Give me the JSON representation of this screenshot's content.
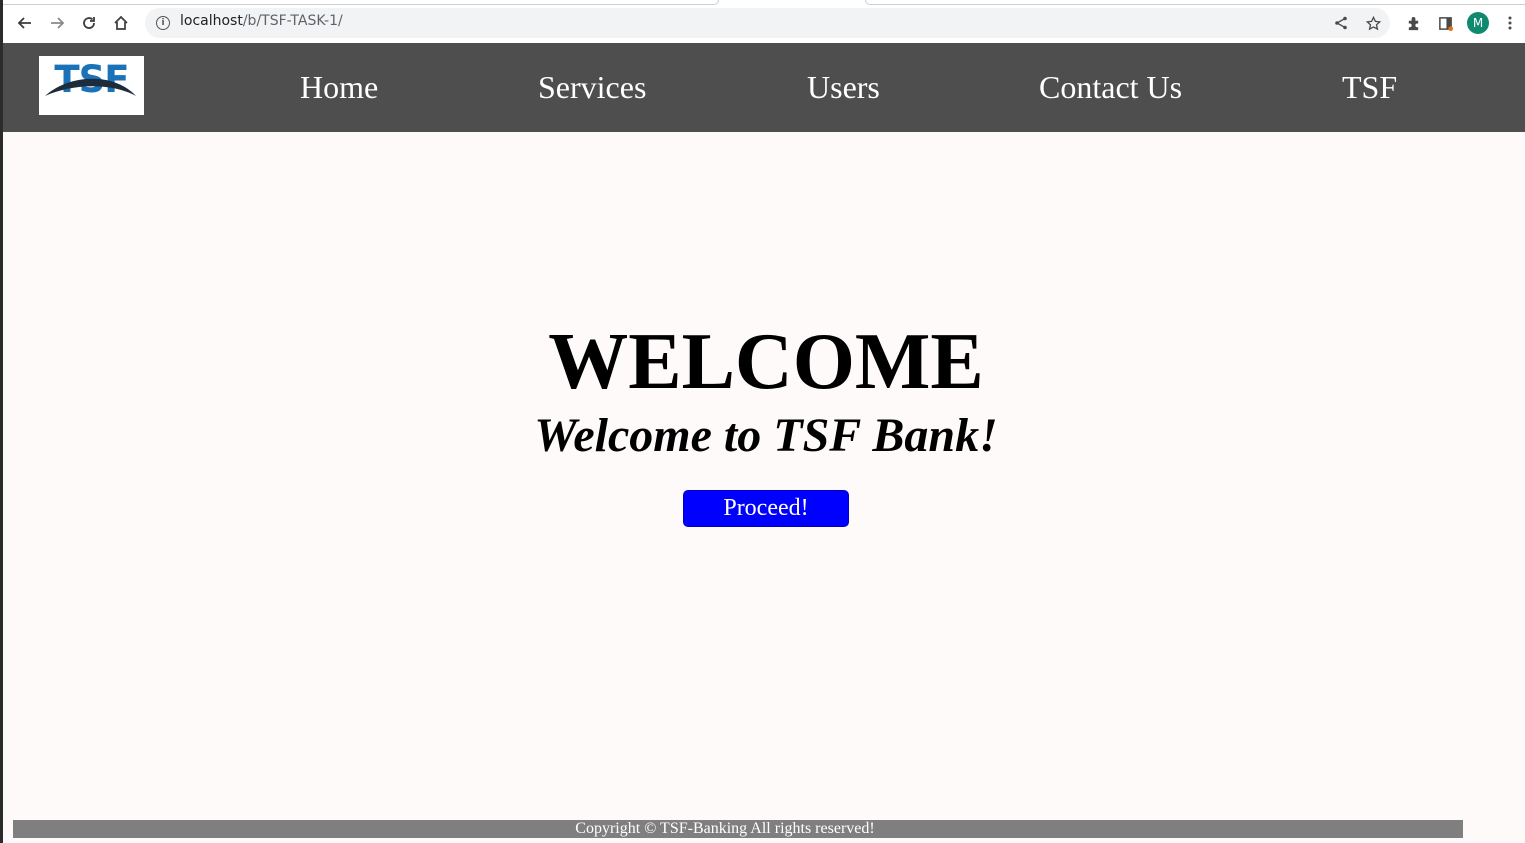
{
  "browser": {
    "url_host": "localhost",
    "url_path": "/b/TSF-TASK-1/",
    "profile_initial": "M",
    "icons": [
      "back-icon",
      "forward-icon",
      "reload-icon",
      "home-icon",
      "info-icon",
      "share-icon",
      "star-icon",
      "extensions-icon",
      "sidebar-icon",
      "menu-icon"
    ]
  },
  "site": {
    "logo_text": "TSF",
    "nav": [
      {
        "label": "Home"
      },
      {
        "label": "Services"
      },
      {
        "label": "Users"
      },
      {
        "label": "Contact Us"
      },
      {
        "label": "TSF"
      }
    ]
  },
  "hero": {
    "title": "WELCOME",
    "subtitle": "Welcome to TSF Bank!",
    "button_label": "Proceed!"
  },
  "footer": {
    "text": "Copyright © TSF-Banking All rights reserved!"
  },
  "colors": {
    "nav_bg": "#4e4e4e",
    "page_bg": "#fffafa",
    "button_bg": "#0000ff",
    "footer_bg": "#7f7f7f",
    "logo_blue": "#1a73b8",
    "logo_dark": "#1d2b3a"
  }
}
